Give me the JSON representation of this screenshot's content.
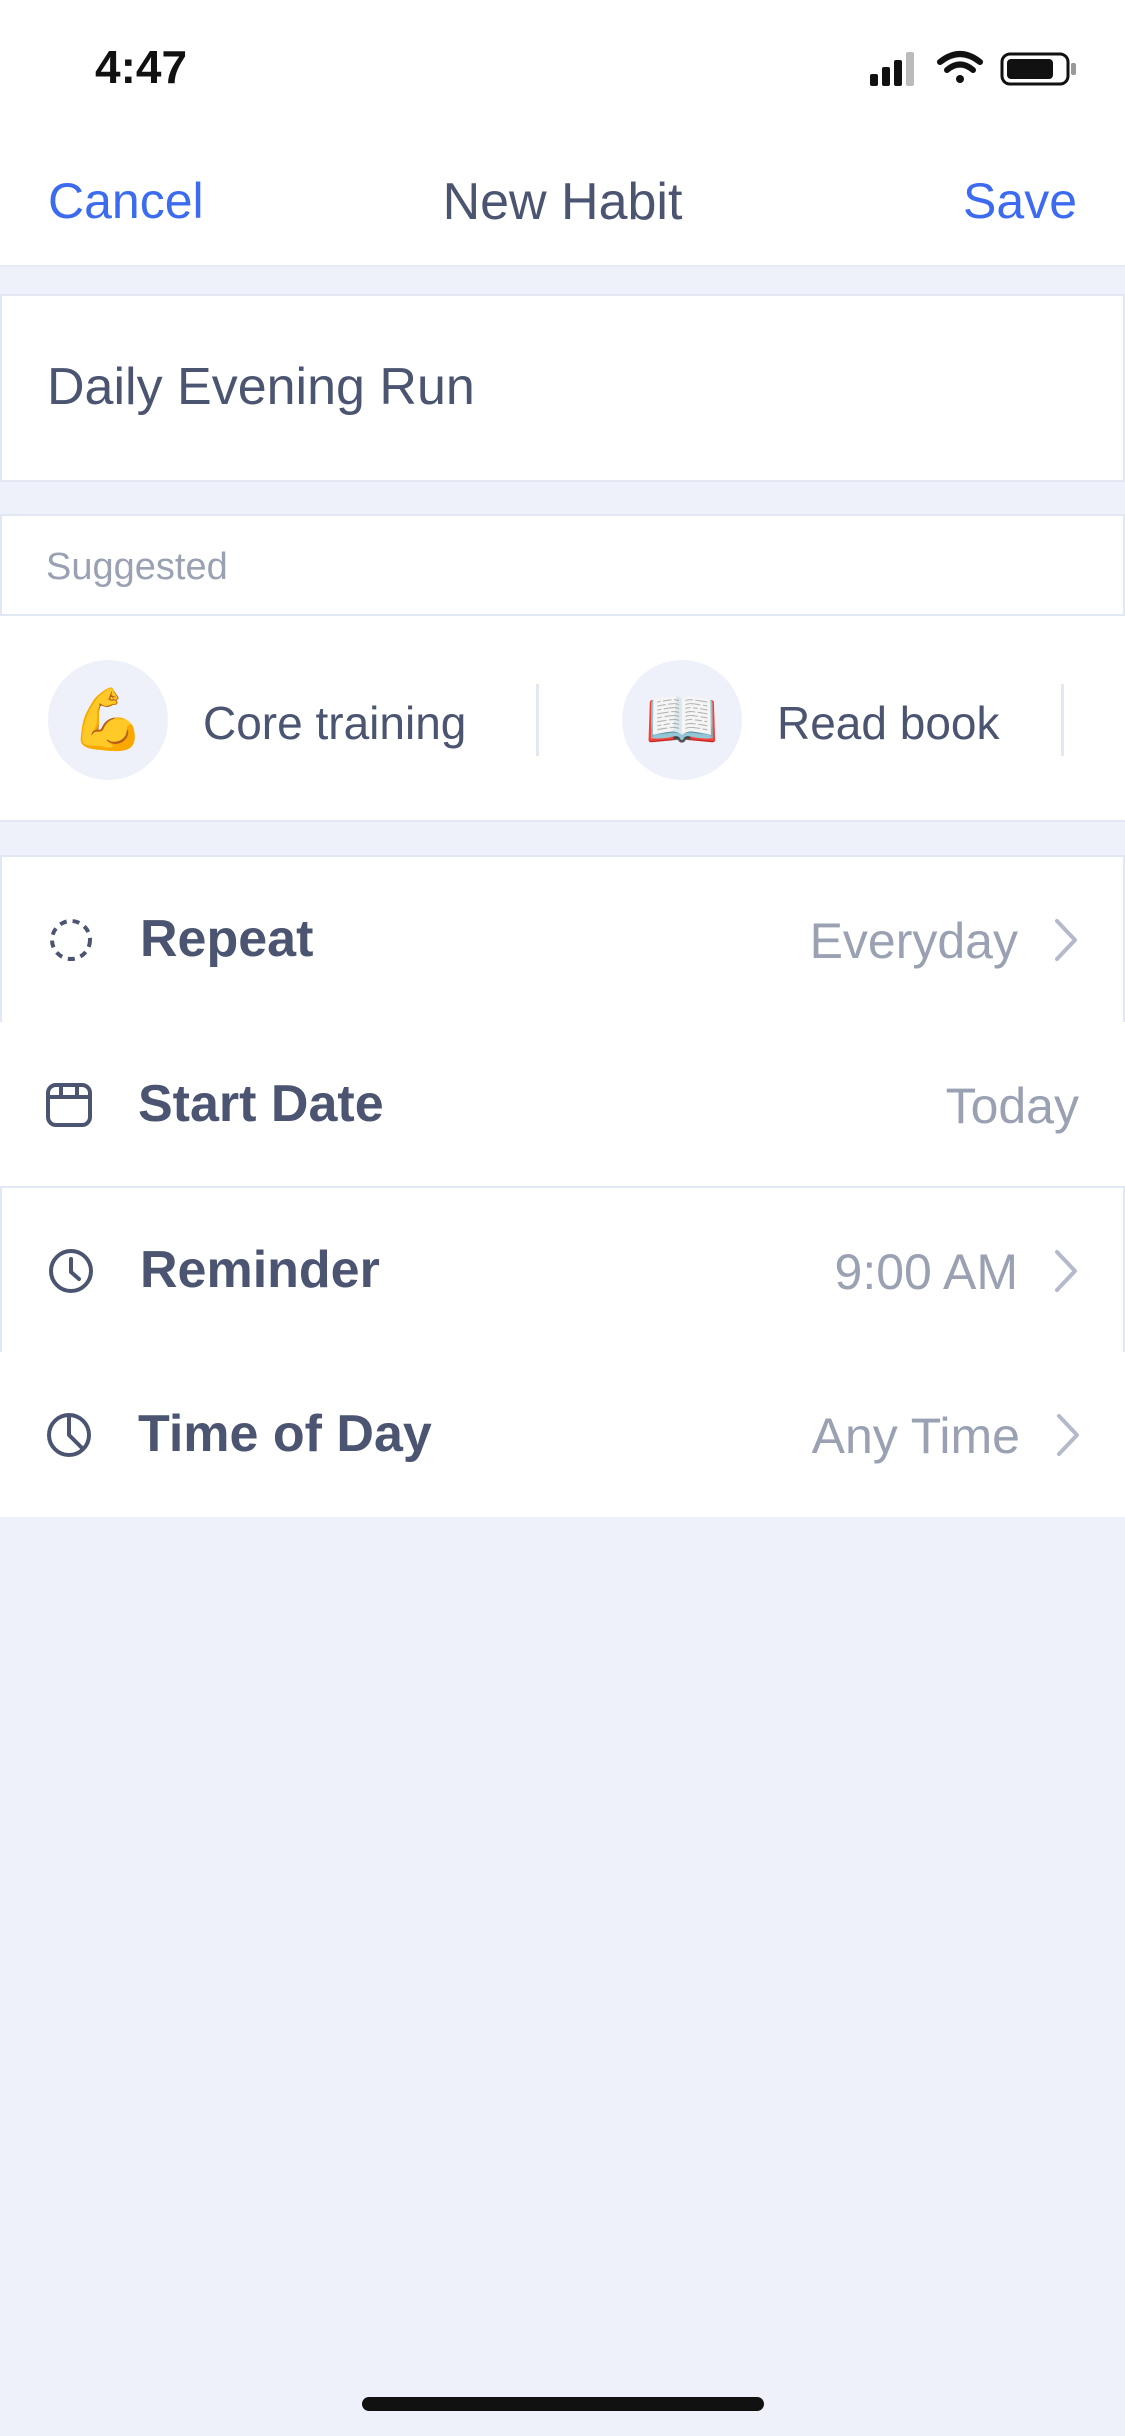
{
  "status_bar": {
    "time": "4:47"
  },
  "nav": {
    "cancel": "Cancel",
    "title": "New Habit",
    "save": "Save"
  },
  "habit_name": {
    "value": "Daily Evening Run",
    "placeholder": ""
  },
  "suggested": {
    "header": "Suggested",
    "items": [
      {
        "emoji": "💪",
        "label": "Core training"
      },
      {
        "emoji": "📖",
        "label": "Read book"
      }
    ]
  },
  "settings": [
    {
      "icon": "repeat-icon",
      "title": "Repeat",
      "value": "Everyday"
    },
    {
      "icon": "calendar-icon",
      "title": "Start Date",
      "value": "Today"
    },
    {
      "icon": "alarm-clock-icon",
      "title": "Reminder",
      "value": "9:00 AM"
    },
    {
      "icon": "time-of-day-icon",
      "title": "Time of Day",
      "value": "Any Time"
    }
  ],
  "colors": {
    "accent": "#3C6BF0",
    "text": "#4B5470",
    "muted": "#9AA1B3",
    "background": "#EEF1FA"
  }
}
